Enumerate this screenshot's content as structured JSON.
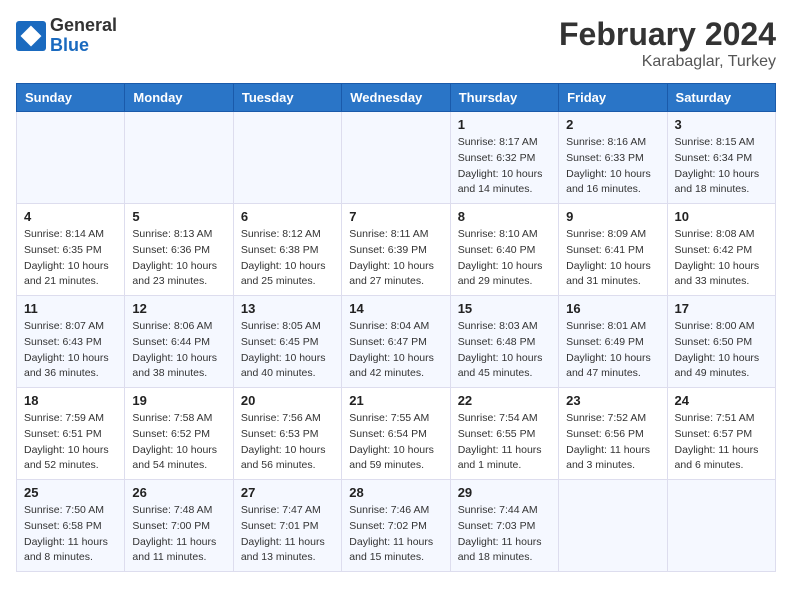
{
  "header": {
    "logo_general": "General",
    "logo_blue": "Blue",
    "title": "February 2024",
    "subtitle": "Karabaglar, Turkey"
  },
  "days_of_week": [
    "Sunday",
    "Monday",
    "Tuesday",
    "Wednesday",
    "Thursday",
    "Friday",
    "Saturday"
  ],
  "weeks": [
    [
      {
        "day": "",
        "info": ""
      },
      {
        "day": "",
        "info": ""
      },
      {
        "day": "",
        "info": ""
      },
      {
        "day": "",
        "info": ""
      },
      {
        "day": "1",
        "info": "Sunrise: 8:17 AM\nSunset: 6:32 PM\nDaylight: 10 hours\nand 14 minutes."
      },
      {
        "day": "2",
        "info": "Sunrise: 8:16 AM\nSunset: 6:33 PM\nDaylight: 10 hours\nand 16 minutes."
      },
      {
        "day": "3",
        "info": "Sunrise: 8:15 AM\nSunset: 6:34 PM\nDaylight: 10 hours\nand 18 minutes."
      }
    ],
    [
      {
        "day": "4",
        "info": "Sunrise: 8:14 AM\nSunset: 6:35 PM\nDaylight: 10 hours\nand 21 minutes."
      },
      {
        "day": "5",
        "info": "Sunrise: 8:13 AM\nSunset: 6:36 PM\nDaylight: 10 hours\nand 23 minutes."
      },
      {
        "day": "6",
        "info": "Sunrise: 8:12 AM\nSunset: 6:38 PM\nDaylight: 10 hours\nand 25 minutes."
      },
      {
        "day": "7",
        "info": "Sunrise: 8:11 AM\nSunset: 6:39 PM\nDaylight: 10 hours\nand 27 minutes."
      },
      {
        "day": "8",
        "info": "Sunrise: 8:10 AM\nSunset: 6:40 PM\nDaylight: 10 hours\nand 29 minutes."
      },
      {
        "day": "9",
        "info": "Sunrise: 8:09 AM\nSunset: 6:41 PM\nDaylight: 10 hours\nand 31 minutes."
      },
      {
        "day": "10",
        "info": "Sunrise: 8:08 AM\nSunset: 6:42 PM\nDaylight: 10 hours\nand 33 minutes."
      }
    ],
    [
      {
        "day": "11",
        "info": "Sunrise: 8:07 AM\nSunset: 6:43 PM\nDaylight: 10 hours\nand 36 minutes."
      },
      {
        "day": "12",
        "info": "Sunrise: 8:06 AM\nSunset: 6:44 PM\nDaylight: 10 hours\nand 38 minutes."
      },
      {
        "day": "13",
        "info": "Sunrise: 8:05 AM\nSunset: 6:45 PM\nDaylight: 10 hours\nand 40 minutes."
      },
      {
        "day": "14",
        "info": "Sunrise: 8:04 AM\nSunset: 6:47 PM\nDaylight: 10 hours\nand 42 minutes."
      },
      {
        "day": "15",
        "info": "Sunrise: 8:03 AM\nSunset: 6:48 PM\nDaylight: 10 hours\nand 45 minutes."
      },
      {
        "day": "16",
        "info": "Sunrise: 8:01 AM\nSunset: 6:49 PM\nDaylight: 10 hours\nand 47 minutes."
      },
      {
        "day": "17",
        "info": "Sunrise: 8:00 AM\nSunset: 6:50 PM\nDaylight: 10 hours\nand 49 minutes."
      }
    ],
    [
      {
        "day": "18",
        "info": "Sunrise: 7:59 AM\nSunset: 6:51 PM\nDaylight: 10 hours\nand 52 minutes."
      },
      {
        "day": "19",
        "info": "Sunrise: 7:58 AM\nSunset: 6:52 PM\nDaylight: 10 hours\nand 54 minutes."
      },
      {
        "day": "20",
        "info": "Sunrise: 7:56 AM\nSunset: 6:53 PM\nDaylight: 10 hours\nand 56 minutes."
      },
      {
        "day": "21",
        "info": "Sunrise: 7:55 AM\nSunset: 6:54 PM\nDaylight: 10 hours\nand 59 minutes."
      },
      {
        "day": "22",
        "info": "Sunrise: 7:54 AM\nSunset: 6:55 PM\nDaylight: 11 hours\nand 1 minute."
      },
      {
        "day": "23",
        "info": "Sunrise: 7:52 AM\nSunset: 6:56 PM\nDaylight: 11 hours\nand 3 minutes."
      },
      {
        "day": "24",
        "info": "Sunrise: 7:51 AM\nSunset: 6:57 PM\nDaylight: 11 hours\nand 6 minutes."
      }
    ],
    [
      {
        "day": "25",
        "info": "Sunrise: 7:50 AM\nSunset: 6:58 PM\nDaylight: 11 hours\nand 8 minutes."
      },
      {
        "day": "26",
        "info": "Sunrise: 7:48 AM\nSunset: 7:00 PM\nDaylight: 11 hours\nand 11 minutes."
      },
      {
        "day": "27",
        "info": "Sunrise: 7:47 AM\nSunset: 7:01 PM\nDaylight: 11 hours\nand 13 minutes."
      },
      {
        "day": "28",
        "info": "Sunrise: 7:46 AM\nSunset: 7:02 PM\nDaylight: 11 hours\nand 15 minutes."
      },
      {
        "day": "29",
        "info": "Sunrise: 7:44 AM\nSunset: 7:03 PM\nDaylight: 11 hours\nand 18 minutes."
      },
      {
        "day": "",
        "info": ""
      },
      {
        "day": "",
        "info": ""
      }
    ]
  ]
}
